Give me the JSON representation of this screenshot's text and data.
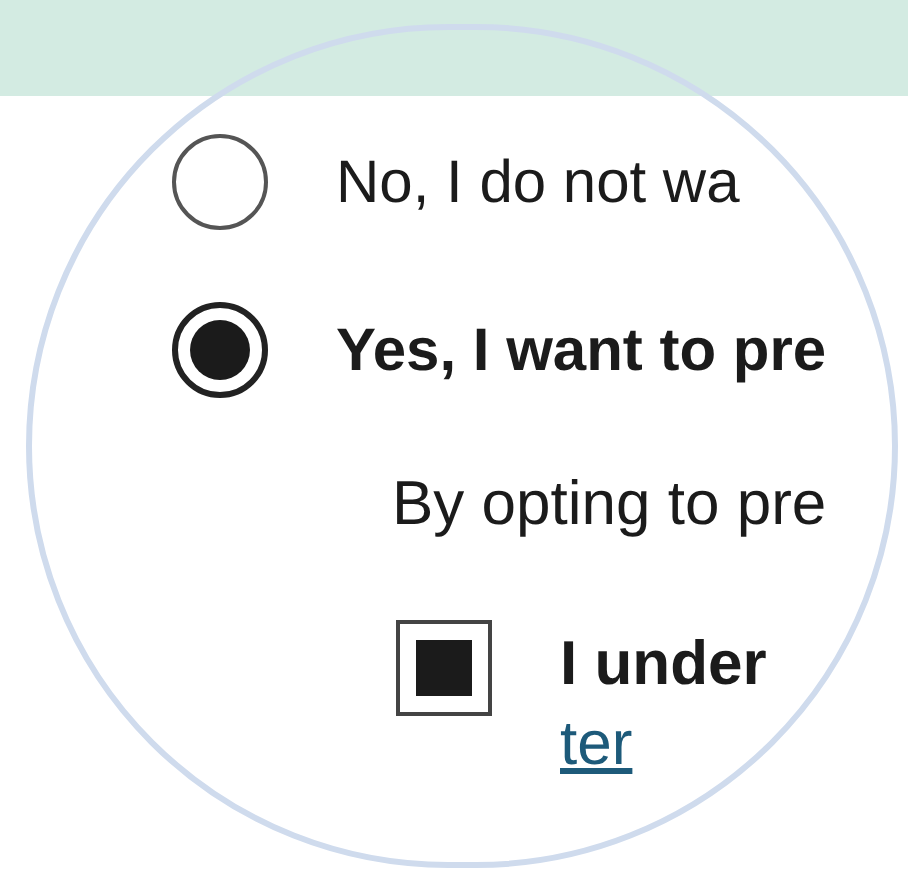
{
  "options": [
    {
      "label": "No, I do not wa",
      "selected": false
    },
    {
      "label": "Yes, I want to pre",
      "selected": true
    }
  ],
  "note": "By opting to pre",
  "agreement": {
    "label": "I under",
    "link": "ter",
    "checked": true
  }
}
